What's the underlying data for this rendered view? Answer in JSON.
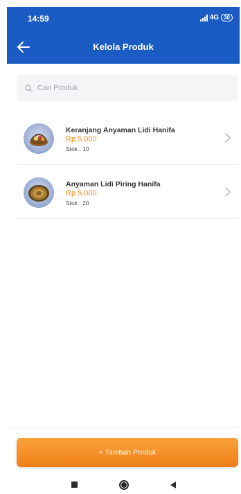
{
  "status_bar": {
    "time": "14:59",
    "network": "4G",
    "battery": "30"
  },
  "app_bar": {
    "title": "Kelola Produk",
    "back_icon": "arrow-left-icon"
  },
  "search": {
    "placeholder": "Cari Produk",
    "value": "",
    "icon": "search-icon"
  },
  "products": [
    {
      "name": "Keranjang Anyaman Lidi Hanifa",
      "price": "Rp 5.000",
      "stock": "Stok : 10"
    },
    {
      "name": "Anyaman Lidi Piring Hanifa",
      "price": "Rp 5.000",
      "stock": "Stok : 20"
    }
  ],
  "footer": {
    "add_button_label": "+ Tambah Produk"
  },
  "colors": {
    "primary": "#1a5bc4",
    "accent": "#f28c1e"
  }
}
